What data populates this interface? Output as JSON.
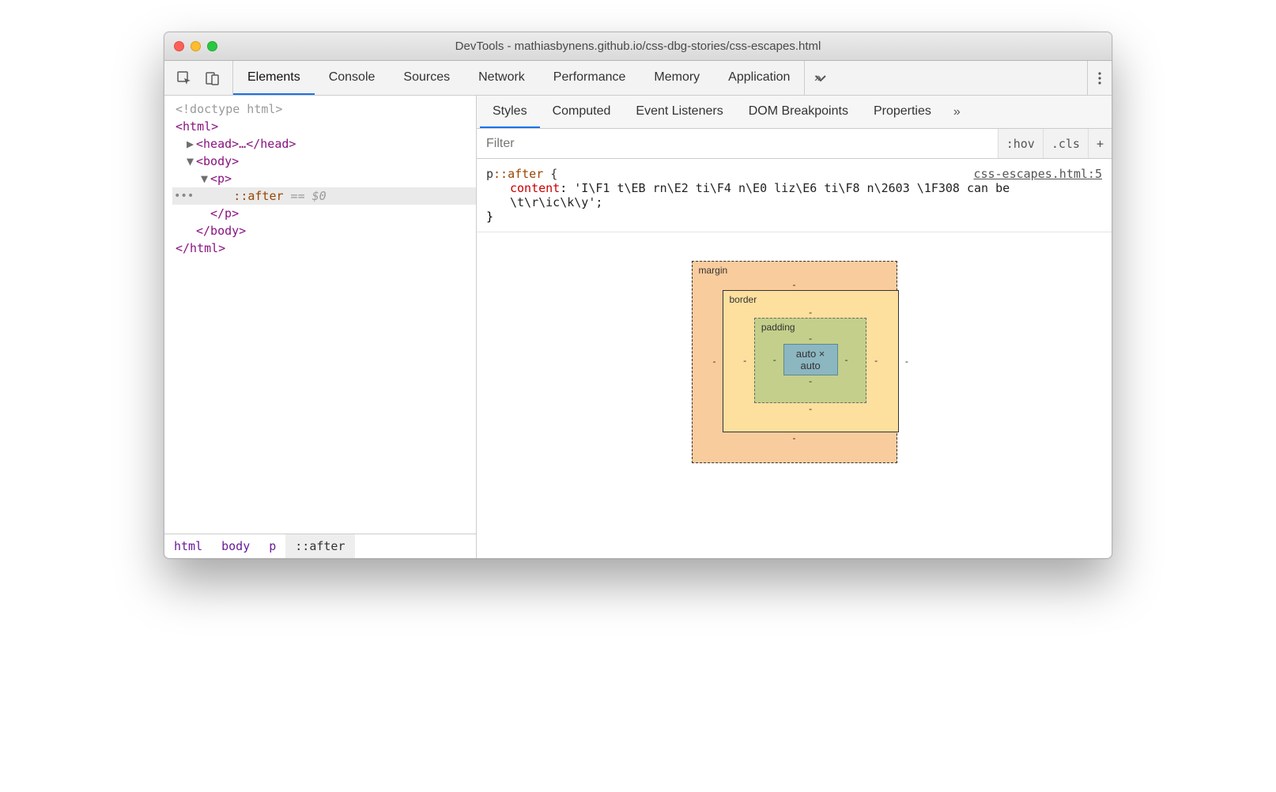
{
  "window": {
    "title": "DevTools - mathiasbynens.github.io/css-dbg-stories/css-escapes.html"
  },
  "toolbar": {
    "tabs": [
      "Elements",
      "Console",
      "Sources",
      "Network",
      "Performance",
      "Memory",
      "Application"
    ],
    "active": "Elements"
  },
  "dom": {
    "lines": {
      "doctype": "<!doctype html>",
      "html_open": "<html>",
      "head": "<head>…</head>",
      "body_open": "<body>",
      "p_open": "<p>",
      "after": "::after",
      "eq0": "== $0",
      "p_close": "</p>",
      "body_close": "</body>",
      "html_close": "</html>"
    }
  },
  "crumbs": [
    "html",
    "body",
    "p",
    "::after"
  ],
  "subtabs": [
    "Styles",
    "Computed",
    "Event Listeners",
    "DOM Breakpoints",
    "Properties"
  ],
  "subtab_active": "Styles",
  "filter": {
    "placeholder": "Filter",
    "hov": ":hov",
    "cls": ".cls",
    "plus": "+"
  },
  "rule": {
    "selector_main": "p",
    "selector_pseudo": "::after",
    "brace_open": " {",
    "prop": "content",
    "value": "'I\\F1 t\\EB rn\\E2 ti\\F4 n\\E0 liz\\E6 ti\\F8 n\\2603 \\1F308 can be \\t\\r\\ic\\k\\y';",
    "brace_close": "}",
    "source": "css-escapes.html:5"
  },
  "boxmodel": {
    "margin_label": "margin",
    "border_label": "border",
    "padding_label": "padding",
    "content": "auto × auto",
    "dash": "-"
  }
}
